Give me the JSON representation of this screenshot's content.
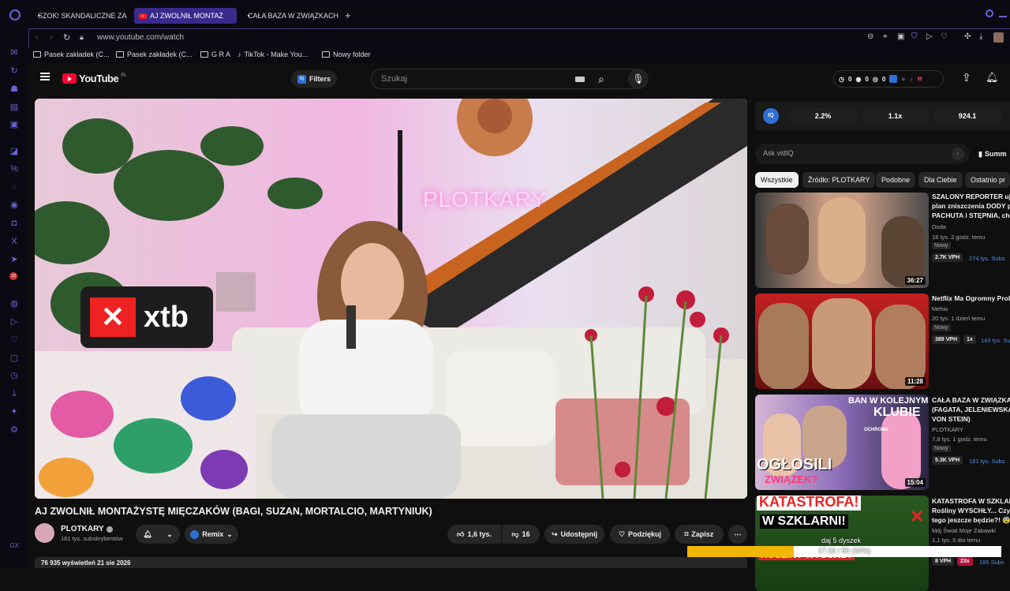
{
  "tabs": [
    {
      "label": "SZOK! SKANDALICZNE ZA",
      "active": false
    },
    {
      "label": "AJ ZWOLNIŁ MONTAŻ",
      "active": true
    },
    {
      "label": "CAŁA BAZA W ZWIĄZKACH",
      "active": false
    }
  ],
  "address": {
    "url": "www.youtube.com/watch"
  },
  "bookmarks": [
    "Pasek zakładek (C...",
    "Pasek zakładek (C...",
    "G R A",
    "TikTok - Make You...",
    "Nowy folder"
  ],
  "masthead": {
    "logo": "YouTube",
    "country": "PL",
    "filters_label": "Filters",
    "search_placeholder": "Szukaj",
    "counters": [
      "0",
      "0",
      "0"
    ]
  },
  "player": {
    "brand_word": "PLOTKARY",
    "overlay_logo": "xtb"
  },
  "video": {
    "title": "AJ ZWOLNIŁ MONTAŻYSTĘ MIĘCZAKÓW (BAGI, SUZAN, MORTALCIO, MARTYNIUK)",
    "channel": "PLOTKARY",
    "subscribers": "181 tys. subskrybentów",
    "remix_label": "Remix",
    "likes": "1,6 tys.",
    "dislikes": "16",
    "share_label": "Udostępnij",
    "thanks_label": "Podziękuj",
    "save_label": "Zapisz",
    "views_date": "76 935 wyświetleń 21 sie 2026"
  },
  "vidiq": {
    "stats": [
      "2.2%",
      "1.1x",
      "924.1"
    ],
    "ask_placeholder": "Ask vidIQ",
    "summary_label": "Summ"
  },
  "chips": [
    "Wszystkie",
    "Źródło: PLOTKARY",
    "Podobne",
    "Dla Ciebie",
    "Ostatnio pr"
  ],
  "recommendations": [
    {
      "title1": "SZALONY REPORTER ujaw",
      "title2": "plan zniszczenia DODY pr",
      "title3": "PACHUTA i STĘPNIA, chc",
      "channel": "Doda",
      "meta": "18 tys.  2 godz. temu",
      "badge": "Nowy",
      "vph": "2.7K VPH",
      "subs": "274 tys. Subs",
      "duration": "36:27"
    },
    {
      "title1": "Netflix Ma Ogromny Prob",
      "title2": "",
      "title3": "",
      "channel": "Mehio",
      "meta": "20 tys.  1 dzień temu",
      "badge": "Nowy",
      "vph": "389 VPH",
      "subs": "143 tys. Su",
      "duration": "11:28",
      "mult": "1x"
    },
    {
      "title1": "CAŁA BAZA W ZWIĄZKAC",
      "title2": "(FAGATA, JELENIEWSKA,",
      "title3": "VON STEIN)",
      "channel": "PLOTKARY",
      "meta": "7,8 tys.  1 godz. temu",
      "badge": "Nowy",
      "vph": "5.3K VPH",
      "subs": "181 tys. Subs",
      "duration": "15:04"
    },
    {
      "title1": "KATASTROFA W SZKLAR",
      "title2": "Rośliny WYSCHŁY... Czy c",
      "title3": "tego jeszcze będzie?! 😰",
      "channel": "Mój Świat Moje Zabawki",
      "meta": "1,1 tys.  5 dni temu",
      "badge": "",
      "vph": "8 VPH",
      "subs": "195 Subs",
      "mult": "23x"
    }
  ],
  "thumb_text": {
    "t3_top": "BAN W KOLEJNYM",
    "t3_club": "KLUBIE",
    "t3_bottom1": "OGŁOSILI",
    "t3_bottom2": "ZWIĄZEK?",
    "t3_ochrona": "OCHRONA",
    "t4_top": "KATASTROFA!",
    "t4_mid": "W SZKLARNI!",
    "t4_bottom": "ROŚLINY WYSCHŁY"
  },
  "download_bar": {
    "label": "daj 5 dyszek",
    "progress_text": "17.00 / 50 (34%)",
    "progress": 0.34
  }
}
